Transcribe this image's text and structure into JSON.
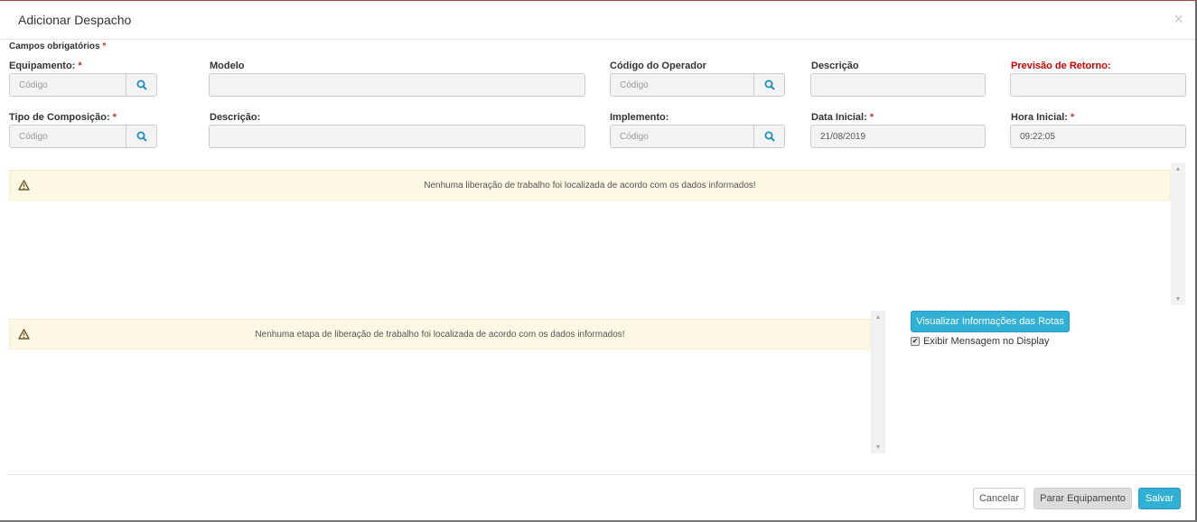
{
  "modal": {
    "title": "Adicionar Despacho",
    "close": "×"
  },
  "required_note": {
    "label": "Campos obrigatórios",
    "star": "*"
  },
  "row1": {
    "equipamento": {
      "label": "Equipamento:",
      "star": "*",
      "placeholder": "Código",
      "value": ""
    },
    "modelo": {
      "label": "Modelo",
      "value": ""
    },
    "codigo_operador": {
      "label": "Código do Operador",
      "placeholder": "Código",
      "value": ""
    },
    "descricao": {
      "label": "Descrição",
      "value": ""
    },
    "previsao_retorno": {
      "label": "Previsão de Retorno:",
      "value": ""
    }
  },
  "row2": {
    "tipo_composicao": {
      "label": "Tipo de Composição:",
      "star": "*",
      "placeholder": "Código",
      "value": ""
    },
    "descricao": {
      "label": "Descrição:",
      "value": ""
    },
    "implemento": {
      "label": "Implemento:",
      "placeholder": "Código",
      "value": ""
    },
    "data_inicial": {
      "label": "Data Inicial:",
      "star": "*",
      "value": "21/08/2019"
    },
    "hora_inicial": {
      "label": "Hora Inicial:",
      "star": "*",
      "value": "09:22:05"
    }
  },
  "alerts": {
    "liberacao": "Nenhuma liberação de trabalho foi localizada de acordo com os dados informados!",
    "etapa": "Nenhuma etapa de liberação de trabalho foi localizada de acordo com os dados informados!"
  },
  "actions": {
    "routes_button": "Visualizar Informações das Rotas",
    "display_checkbox": {
      "label": "Exibir Mensagem no Display",
      "checked": true,
      "mark": "✔"
    }
  },
  "footer": {
    "cancel": "Cancelar",
    "stop": "Parar Equipamento",
    "save": "Salvar"
  },
  "icons": {
    "search": "search-icon",
    "warning": "warning-icon",
    "close": "close-icon"
  },
  "colors": {
    "accent": "#31b0d5",
    "required": "#c9302c",
    "warning_bg": "#fcf8e3",
    "highlight_label": "#d00000"
  }
}
